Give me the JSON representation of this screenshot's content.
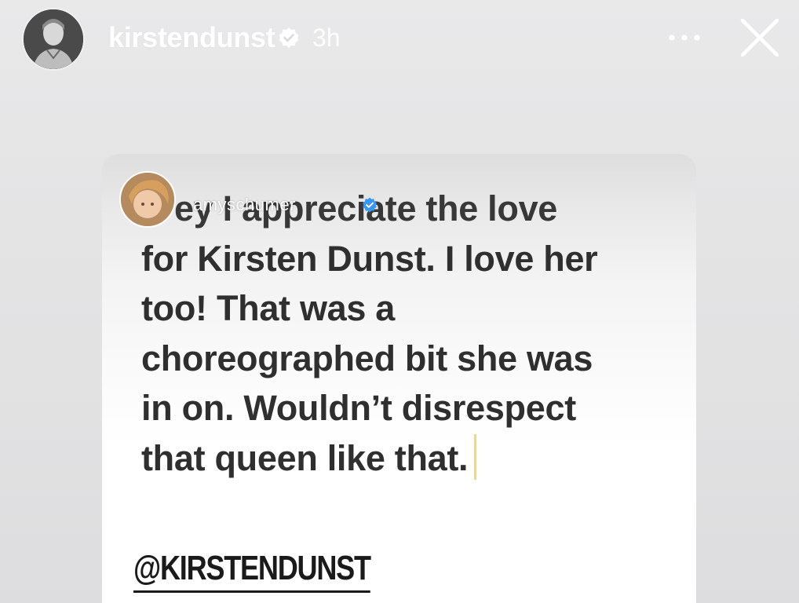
{
  "header": {
    "username": "kirstendunst",
    "timestamp": "3h",
    "avatar_icon": "profile-avatar",
    "verified_icon": "verified-badge-icon",
    "more_icon": "more-options-icon",
    "close_icon": "close-icon"
  },
  "reply": {
    "username": "amyschumer",
    "verified_icon": "verified-badge-icon",
    "lines": [
      "ey I appreciate the love",
      "for Kirsten Dunst. I love her",
      "too! That was a",
      "choreographed bit she was",
      "in on. Wouldn’t disrespect",
      "that queen like that."
    ],
    "mention": "@KIRSTENDUNST"
  },
  "colors": {
    "background": "#e4e4e5",
    "header_text": "#ffffff",
    "message_text": "#2f2f2f",
    "verified_blue": "#3897f0",
    "caret": "#e8d6a0"
  }
}
